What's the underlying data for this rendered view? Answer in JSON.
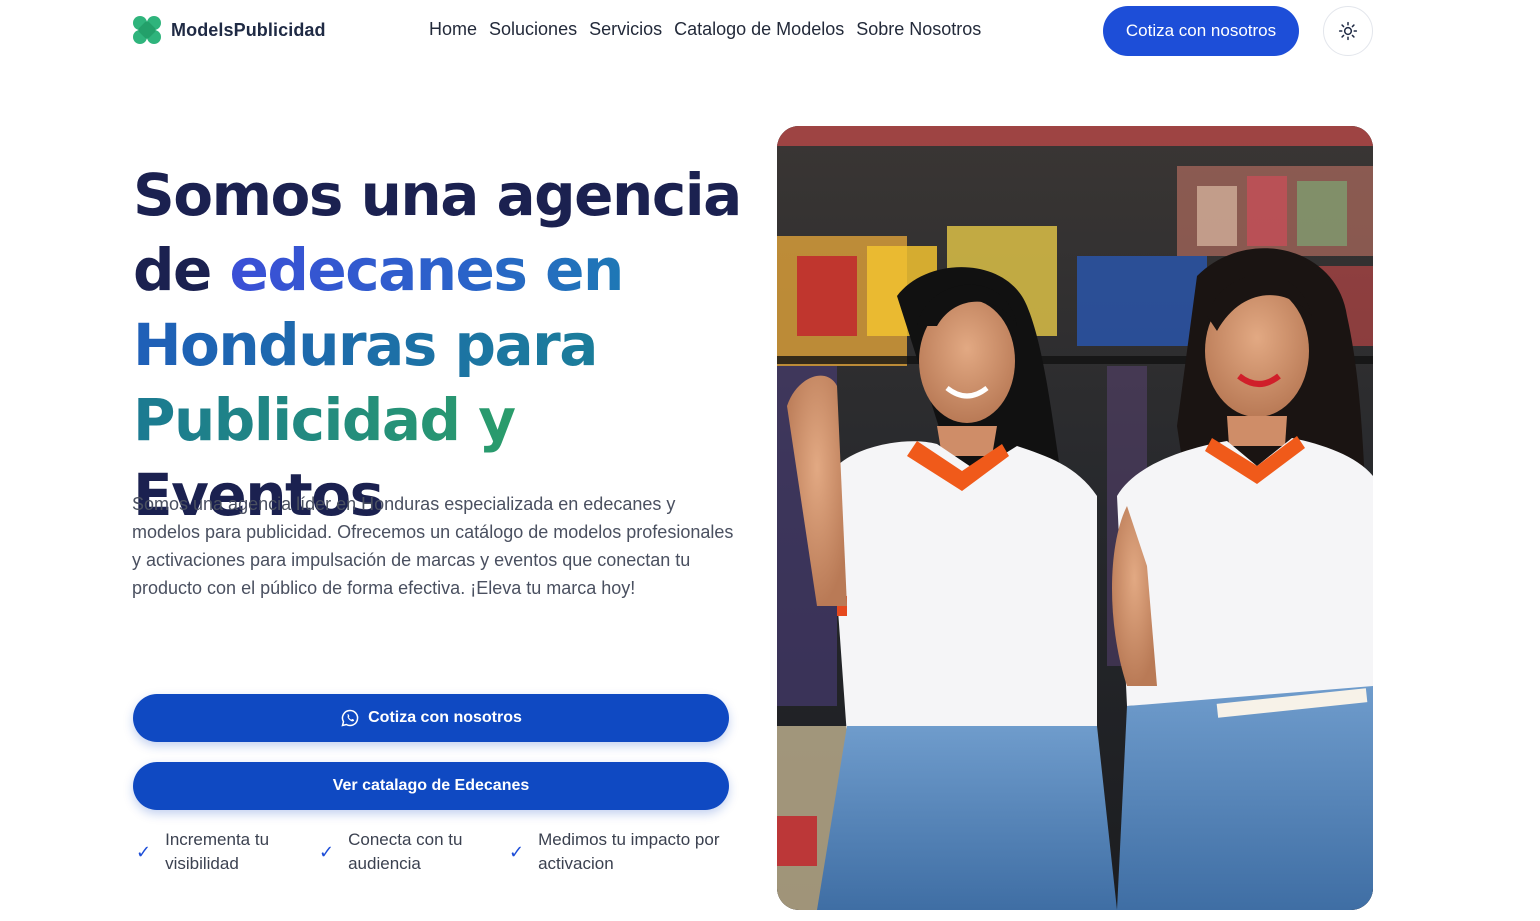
{
  "brand": {
    "name": "ModelsPublicidad",
    "logo_color": "#2fb47c"
  },
  "nav": {
    "items": [
      "Home",
      "Soluciones",
      "Servicios",
      "Catalogo de Modelos",
      "Sobre Nosotros"
    ],
    "cta_label": "Cotiza con nosotros",
    "theme_icon": "sun-icon"
  },
  "hero": {
    "headline": {
      "part1": "Somos una agencia",
      "part2_a": "de ",
      "part2_b": "edecanes en",
      "part3": "Honduras para",
      "part4_a": "Publicidad y",
      "part4_b": " Eventos"
    },
    "lead": "Somos una agencia líder en Honduras especializada en edecanes y modelos para publicidad. Ofrecemos un catálogo de modelos profesionales y activaciones para impulsación de marcas y eventos que conectan tu producto con el público de forma efectiva. ¡Eleva tu marca hoy!",
    "primary_cta": "Cotiza con nosotros",
    "secondary_cta": "Ver catalago de Edecanes",
    "features": [
      {
        "text": "Incrementa tu visibilidad"
      },
      {
        "text": "Conecta con tu audiencia"
      },
      {
        "text": "Medimos tu impacto por activacion"
      }
    ]
  },
  "colors": {
    "accent": "#1d4ed8",
    "button": "#0f49c2",
    "heading": "#1b2150",
    "text": "#4a5060"
  }
}
